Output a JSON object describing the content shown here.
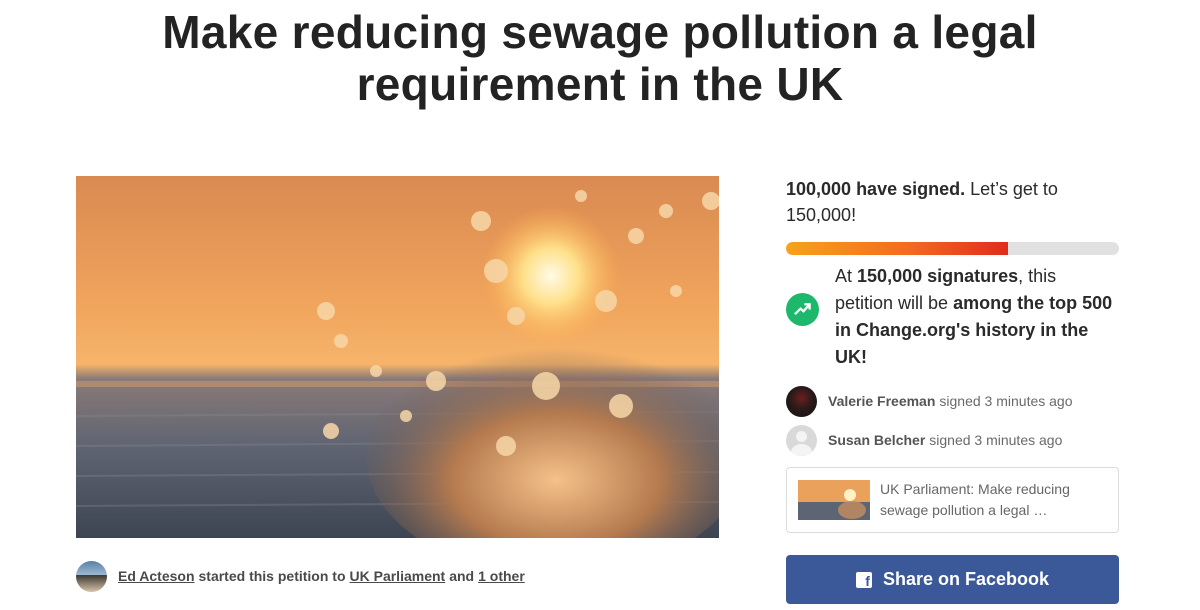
{
  "petition": {
    "title": "Make reducing sewage pollution a legal requirement in the UK"
  },
  "starter": {
    "name": "Ed Acteson",
    "verb": "started this petition to",
    "target": "UK Parliament",
    "and": "and",
    "others": "1 other"
  },
  "progress": {
    "count_text": "100,000 have signed.",
    "goal_text": "Let’s get to 150,000!",
    "fraction": 0.6667
  },
  "milestone": {
    "prefix": "At",
    "count": "150,000 signatures",
    "middle": ", this petition will be",
    "highlight": "among the top 500 in Change.org's history in the UK!"
  },
  "recent_signers": [
    {
      "name": "Valerie Freeman",
      "status": "signed 3 minutes ago"
    },
    {
      "name": "Susan Belcher",
      "status": "signed 3 minutes ago"
    }
  ],
  "share_card": {
    "text": "UK Parliament: Make reducing sewage pollution a legal …"
  },
  "share_button": {
    "label": "Share on Facebook"
  },
  "colors": {
    "facebook": "#3b5998",
    "trend_green": "#1db86b",
    "progress_start": "#f7a21c",
    "progress_end": "#e02b1e"
  }
}
